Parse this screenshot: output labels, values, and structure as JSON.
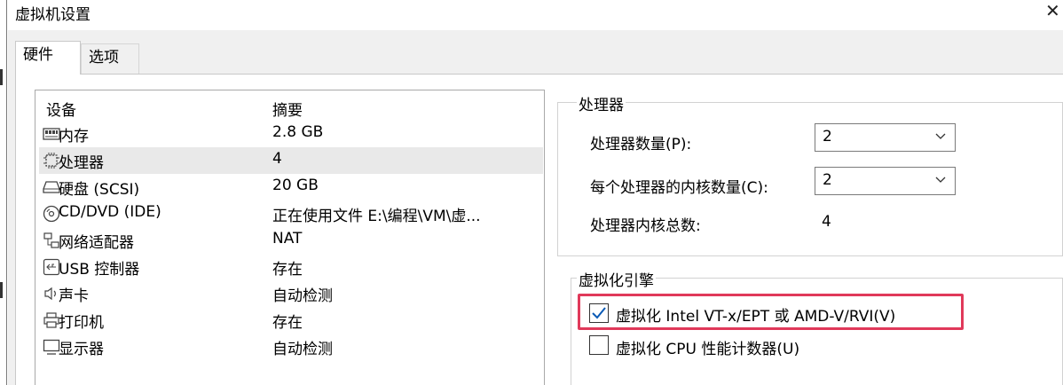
{
  "window": {
    "title": "虚拟机设置",
    "close_glyph": "✕"
  },
  "tabs": [
    {
      "label": "硬件",
      "active": true
    },
    {
      "label": "选项",
      "active": false
    }
  ],
  "device_list": {
    "columns": [
      "设备",
      "摘要"
    ],
    "rows": [
      {
        "icon": "memory-icon",
        "name": "内存",
        "summary": "2.8 GB",
        "selected": false
      },
      {
        "icon": "processor-icon",
        "name": "处理器",
        "summary": "4",
        "selected": true
      },
      {
        "icon": "harddisk-icon",
        "name": "硬盘 (SCSI)",
        "summary": "20 GB",
        "selected": false
      },
      {
        "icon": "cd-dvd-icon",
        "name": "CD/DVD (IDE)",
        "summary": "正在使用文件 E:\\编程\\VM\\虚...",
        "selected": false
      },
      {
        "icon": "network-adapter-icon",
        "name": "网络适配器",
        "summary": "NAT",
        "selected": false
      },
      {
        "icon": "usb-controller-icon",
        "name": "USB 控制器",
        "summary": "存在",
        "selected": false
      },
      {
        "icon": "sound-card-icon",
        "name": "声卡",
        "summary": "自动检测",
        "selected": false
      },
      {
        "icon": "printer-icon",
        "name": "打印机",
        "summary": "存在",
        "selected": false
      },
      {
        "icon": "display-icon",
        "name": "显示器",
        "summary": "自动检测",
        "selected": false
      }
    ]
  },
  "processor": {
    "group_title": "处理器",
    "count_label": "处理器数量(P):",
    "count_value": "2",
    "cores_label": "每个处理器的内核数量(C):",
    "cores_value": "2",
    "total_label": "处理器内核总数:",
    "total_value": "4"
  },
  "virtualization": {
    "group_title": "虚拟化引擎",
    "vtx_label": "虚拟化 Intel VT-x/EPT 或 AMD-V/RVI(V)",
    "vtx_checked": true,
    "cpu_counter_label": "虚拟化 CPU 性能计数器(U)",
    "cpu_counter_checked": false
  },
  "colors": {
    "highlight": "#e0395a",
    "checkmark": "#0a5ab5",
    "selected_row": "#e9e9e9"
  }
}
